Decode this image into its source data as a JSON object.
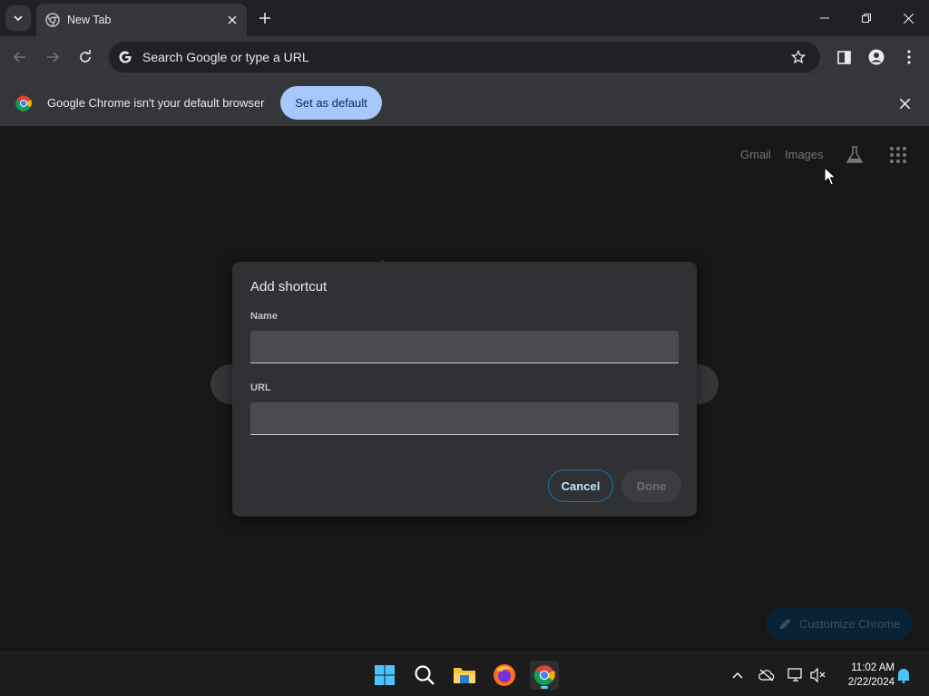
{
  "browser": {
    "tab": {
      "title": "New Tab"
    },
    "omnibox": {
      "placeholder": "Search Google or type a URL"
    }
  },
  "infobar": {
    "message": "Google Chrome isn't your default browser",
    "button_label": "Set as default"
  },
  "ntp": {
    "links": {
      "gmail": "Gmail",
      "images": "Images"
    },
    "customize_label": "Customize Chrome"
  },
  "dialog": {
    "title": "Add shortcut",
    "name_label": "Name",
    "name_value": "",
    "url_label": "URL",
    "url_value": "",
    "cancel_label": "Cancel",
    "done_label": "Done"
  },
  "taskbar": {
    "apps": [
      "start-icon",
      "search-icon",
      "file-explorer-icon",
      "firefox-icon",
      "chrome-icon"
    ],
    "clock": {
      "time": "11:02 AM",
      "date": "2/22/2024"
    }
  },
  "colors": {
    "accent": "#a8c7fa",
    "dialog_bg": "#303134",
    "page_bg": "#1f1f1f",
    "toolbar_bg": "#35363a"
  }
}
